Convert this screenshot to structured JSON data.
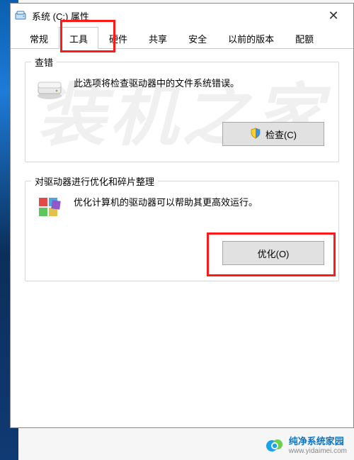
{
  "window": {
    "title": "系统 (C:) 属性",
    "close_glyph": "✕"
  },
  "tabs": {
    "items": [
      {
        "label": "常规"
      },
      {
        "label": "工具",
        "active": true
      },
      {
        "label": "硬件"
      },
      {
        "label": "共享"
      },
      {
        "label": "安全"
      },
      {
        "label": "以前的版本"
      },
      {
        "label": "配额"
      }
    ]
  },
  "group_check": {
    "legend": "查错",
    "description": "此选项将检查驱动器中的文件系统错误。",
    "button_label": "检查(C)"
  },
  "group_optimize": {
    "legend": "对驱动器进行优化和碎片整理",
    "description": "优化计算机的驱动器可以帮助其更高效运行。",
    "button_label": "优化(O)"
  },
  "watermark": "装机之家",
  "footer": {
    "title": "纯净系统家园",
    "url": "www.yidaimei.com"
  }
}
